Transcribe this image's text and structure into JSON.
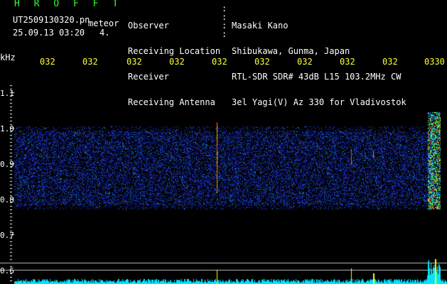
{
  "header": {
    "app_name": "H R O F F T",
    "filename": "UT2509130320.pn",
    "event_type": "meteor",
    "datetime": "25.09.13 03:20",
    "count": "4.",
    "info_labels": [
      "Observer",
      "Receiving Location",
      "Receiver",
      "Receiving Antenna"
    ],
    "info_values": [
      "Masaki Kano",
      "Shibukawa, Gunma, Japan",
      "RTL-SDR SDR# 43dB L15 103.2MHz CW",
      "3el Yagi(V) Az 330 for Vladivostok"
    ]
  },
  "axis": {
    "unit_label": "kHz",
    "time_ticks": [
      "032",
      "032",
      "032",
      "032",
      "032",
      "032",
      "032",
      "032",
      "032",
      "0330"
    ],
    "freq_ticks": [
      "1.1",
      "1.0",
      "0.9",
      "0.8",
      "0.7",
      "0.6"
    ]
  },
  "colors": {
    "background": "#000000",
    "text": "#ffffff",
    "title": "#33ff33",
    "ticks": "#ffff33",
    "noise": "#2233cc",
    "signal": "#00ffff",
    "power": "#00e5ff"
  }
}
